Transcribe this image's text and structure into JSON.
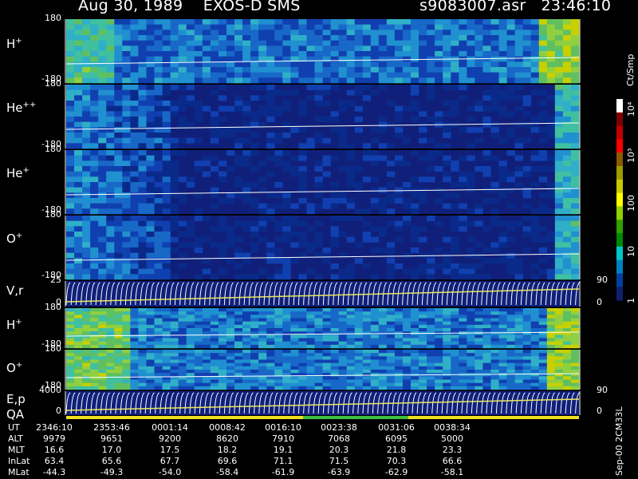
{
  "header": {
    "date": "Aug 30, 1989",
    "instrument": "EXOS-D SMS",
    "file": "s9083007.asr",
    "time": "23:46:10"
  },
  "panels": [
    {
      "label_main": "H",
      "label_sup": "+",
      "top_tick": "180",
      "bottom_tick": "-180"
    },
    {
      "label_main": "He",
      "label_sup": "++",
      "top_tick": "180",
      "bottom_tick": "-180"
    },
    {
      "label_main": "He",
      "label_sup": "+",
      "top_tick": "180",
      "bottom_tick": "-180"
    },
    {
      "label_main": "O",
      "label_sup": "+",
      "top_tick": "180",
      "bottom_tick": "-180"
    },
    {
      "label_main": "V,r",
      "label_sup": "",
      "top_tick": "25",
      "bottom_tick": "0",
      "right_top": "90",
      "right_bottom": "0"
    },
    {
      "label_main": "H",
      "label_sup": "+",
      "top_tick": "180",
      "bottom_tick": "-180"
    },
    {
      "label_main": "O",
      "label_sup": "+",
      "top_tick": "180",
      "bottom_tick": "-180"
    },
    {
      "label_main": "E,p",
      "label_sup": "",
      "top_tick": "4000",
      "bottom_tick": "0",
      "right_top": "90",
      "right_bottom": "0"
    }
  ],
  "qa_label": "QA",
  "colorbar": {
    "unit": "Ct/Smp",
    "ticks": [
      "10⁴",
      "10³",
      "100",
      "10",
      "1"
    ],
    "colors": [
      "#ffffff",
      "#7f0000",
      "#c00000",
      "#ff0000",
      "#8b5a00",
      "#9b9b00",
      "#c8c800",
      "#ffff00",
      "#8fd000",
      "#2fa000",
      "#008800",
      "#00c8c8",
      "#0080c0",
      "#0040a0",
      "#102070"
    ]
  },
  "chart_data": {
    "type": "heatmap",
    "title": "Aug 30, 1989   EXOS-D SMS",
    "x_ticks": [
      "2346:10",
      "2353:46",
      "0001:14",
      "0008:42",
      "0016:10",
      "0023:38",
      "0031:06",
      "0038:34"
    ],
    "xlabel": "UT",
    "panels": [
      "H+",
      "He++",
      "He+",
      "O+",
      "V,r",
      "H+",
      "O+",
      "E,p"
    ],
    "colorbar_range": [
      1,
      10000
    ],
    "colorbar_unit": "Ct/Smp"
  },
  "table": {
    "rows": [
      {
        "label": "UT",
        "values": [
          "2346:10",
          "2353:46",
          "0001:14",
          "0008:42",
          "0016:10",
          "0023:38",
          "0031:06",
          "0038:34"
        ]
      },
      {
        "label": "ALT",
        "values": [
          "9979",
          "9651",
          "9200",
          "8620",
          "7910",
          "7068",
          "6095",
          "5000"
        ]
      },
      {
        "label": "MLT",
        "values": [
          "16.6",
          "17.0",
          "17.5",
          "18.2",
          "19.1",
          "20.3",
          "21.8",
          "23.3"
        ]
      },
      {
        "label": "InLat",
        "values": [
          "63.4",
          "65.6",
          "67.7",
          "69.6",
          "71.1",
          "71.5",
          "70.3",
          "66.6"
        ]
      },
      {
        "label": "MLat",
        "values": [
          "-44.3",
          "-49.3",
          "-54.0",
          "-58.4",
          "-61.9",
          "-63.9",
          "-62.9",
          "-58.1"
        ]
      }
    ]
  },
  "footer_vertical": "Sep-00 2CM33L"
}
